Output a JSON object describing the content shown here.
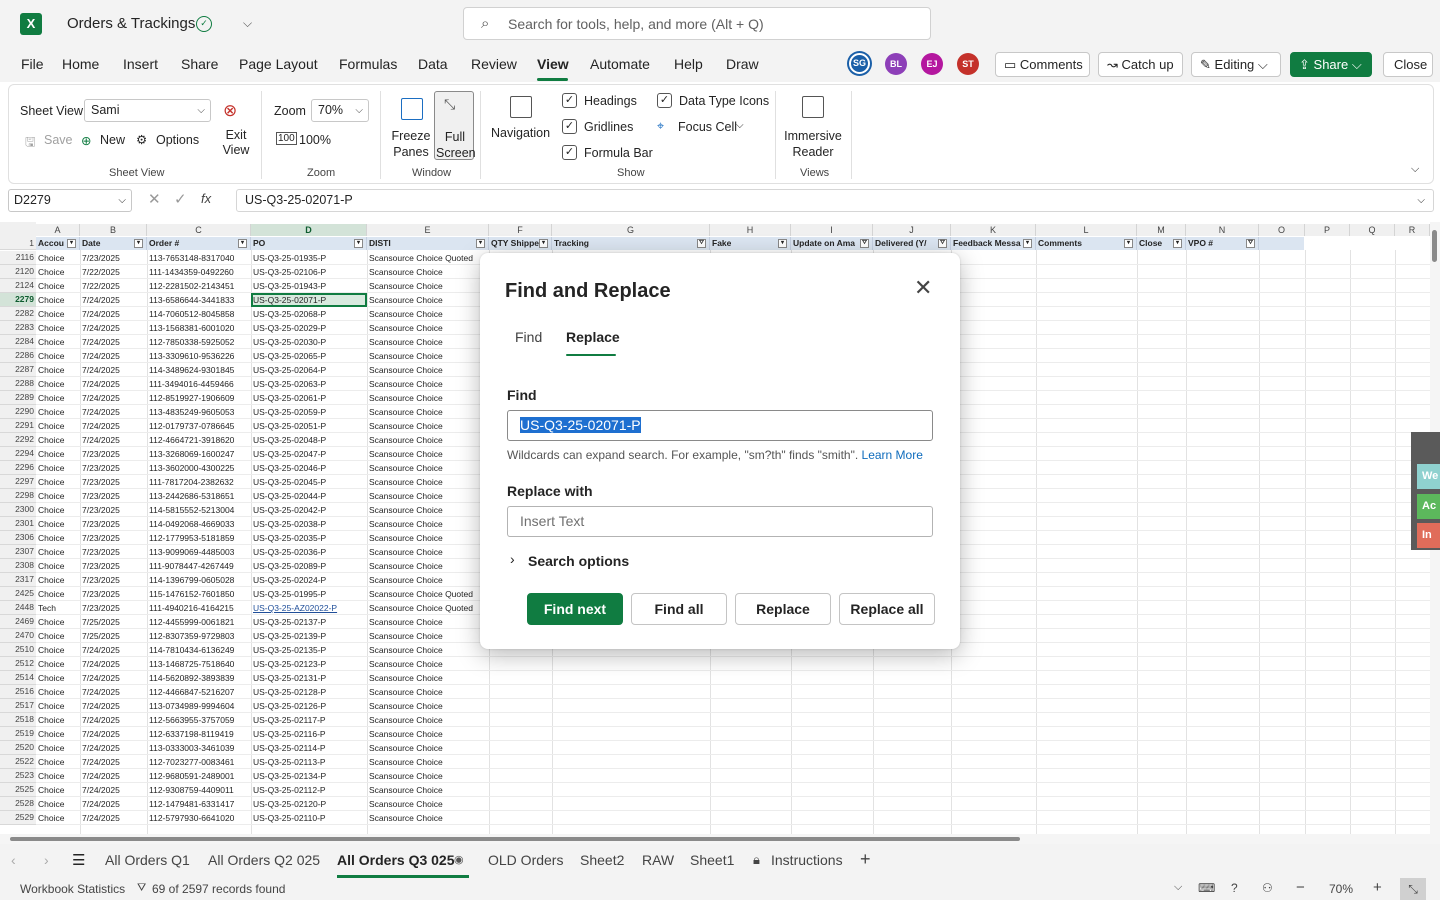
{
  "title_bar": {
    "app_icon": "X",
    "doc_title": "Orders & Trackings",
    "search_placeholder": "Search for tools, help, and more (Alt + Q)"
  },
  "menu": [
    "File",
    "Home",
    "Insert",
    "Share",
    "Page Layout",
    "Formulas",
    "Data",
    "Review",
    "View",
    "Automate",
    "Help",
    "Draw"
  ],
  "active_menu": "View",
  "avatars": [
    {
      "initials": "SG",
      "color": "#1a5fa8"
    },
    {
      "initials": "BL",
      "color": "#8d3fb8"
    },
    {
      "initials": "EJ",
      "color": "#b4179f"
    },
    {
      "initials": "ST",
      "color": "#c4312a"
    }
  ],
  "header_buttons": {
    "comments": "Comments",
    "catchup": "Catch up",
    "editing": "Editing",
    "share": "Share",
    "close": "Close"
  },
  "ribbon": {
    "sheet_view_label": "Sheet View",
    "sheet_view_value": "Sami",
    "save": "Save",
    "new": "New",
    "options": "Options",
    "exit_view": "Exit View",
    "group_sheet_view": "Sheet View",
    "zoom_label": "Zoom",
    "zoom_value": "70%",
    "zoom_100": "100%",
    "group_zoom": "Zoom",
    "freeze_panes": "Freeze Panes",
    "full_screen": "Full Screen",
    "group_window": "Window",
    "navigation": "Navigation",
    "headings": "Headings",
    "gridlines": "Gridlines",
    "formula_bar": "Formula Bar",
    "data_type_icons": "Data Type Icons",
    "focus_cell": "Focus Cell",
    "group_show": "Show",
    "immersive_reader": "Immersive Reader",
    "group_views": "Views"
  },
  "formula_bar": {
    "name_box": "D2279",
    "fx": "fx",
    "content": "US-Q3-25-02071-P"
  },
  "columns": [
    "A",
    "B",
    "C",
    "D",
    "E",
    "F",
    "G",
    "H",
    "I",
    "J",
    "K",
    "L",
    "M",
    "N",
    "O",
    "P",
    "Q",
    "R"
  ],
  "header_row": {
    "num": "1",
    "cells": [
      "Accou",
      "Date",
      "Order #",
      "PO",
      "DISTI",
      "QTY Shippe",
      "Tracking",
      "Fake",
      "Update on Ama",
      "Delivered (Y/",
      "Feedback Messa",
      "Comments",
      "Close",
      "VPO #"
    ]
  },
  "rows": [
    [
      "2116",
      "Choice",
      "7/23/2025",
      "113-7653148-8317040",
      "US-Q3-25-01935-P",
      "Scansource Choice Quoted"
    ],
    [
      "2120",
      "Choice",
      "7/22/2025",
      "111-1434359-0492260",
      "US-Q3-25-02106-P",
      "Scansource Choice"
    ],
    [
      "2124",
      "Choice",
      "7/22/2025",
      "112-2281502-2143451",
      "US-Q3-25-01943-P",
      "Scansource Choice"
    ],
    [
      "2279",
      "Choice",
      "7/24/2025",
      "113-6586644-3441833",
      "US-Q3-25-02071-P",
      "Scansource Choice"
    ],
    [
      "2282",
      "Choice",
      "7/24/2025",
      "114-7060512-8045858",
      "US-Q3-25-02068-P",
      "Scansource Choice"
    ],
    [
      "2283",
      "Choice",
      "7/24/2025",
      "113-1568381-6001020",
      "US-Q3-25-02029-P",
      "Scansource Choice"
    ],
    [
      "2284",
      "Choice",
      "7/24/2025",
      "112-7850338-5925052",
      "US-Q3-25-02030-P",
      "Scansource Choice"
    ],
    [
      "2286",
      "Choice",
      "7/24/2025",
      "113-3309610-9536226",
      "US-Q3-25-02065-P",
      "Scansource Choice"
    ],
    [
      "2287",
      "Choice",
      "7/24/2025",
      "114-3489624-9301845",
      "US-Q3-25-02064-P",
      "Scansource Choice"
    ],
    [
      "2288",
      "Choice",
      "7/24/2025",
      "111-3494016-4459466",
      "US-Q3-25-02063-P",
      "Scansource Choice"
    ],
    [
      "2289",
      "Choice",
      "7/24/2025",
      "112-8519927-1906609",
      "US-Q3-25-02061-P",
      "Scansource Choice"
    ],
    [
      "2290",
      "Choice",
      "7/24/2025",
      "113-4835249-9605053",
      "US-Q3-25-02059-P",
      "Scansource Choice"
    ],
    [
      "2291",
      "Choice",
      "7/24/2025",
      "112-0179737-0786645",
      "US-Q3-25-02051-P",
      "Scansource Choice"
    ],
    [
      "2292",
      "Choice",
      "7/24/2025",
      "112-4664721-3918620",
      "US-Q3-25-02048-P",
      "Scansource Choice"
    ],
    [
      "2294",
      "Choice",
      "7/23/2025",
      "113-3268069-1600247",
      "US-Q3-25-02047-P",
      "Scansource Choice"
    ],
    [
      "2296",
      "Choice",
      "7/23/2025",
      "113-3602000-4300225",
      "US-Q3-25-02046-P",
      "Scansource Choice"
    ],
    [
      "2297",
      "Choice",
      "7/23/2025",
      "111-7817204-2382632",
      "US-Q3-25-02045-P",
      "Scansource Choice"
    ],
    [
      "2298",
      "Choice",
      "7/23/2025",
      "113-2442686-5318651",
      "US-Q3-25-02044-P",
      "Scansource Choice"
    ],
    [
      "2300",
      "Choice",
      "7/23/2025",
      "114-5815552-5213004",
      "US-Q3-25-02042-P",
      "Scansource Choice"
    ],
    [
      "2301",
      "Choice",
      "7/23/2025",
      "114-0492068-4669033",
      "US-Q3-25-02038-P",
      "Scansource Choice"
    ],
    [
      "2306",
      "Choice",
      "7/23/2025",
      "112-1779953-5181859",
      "US-Q3-25-02035-P",
      "Scansource Choice"
    ],
    [
      "2307",
      "Choice",
      "7/23/2025",
      "113-9099069-4485003",
      "US-Q3-25-02036-P",
      "Scansource Choice"
    ],
    [
      "2308",
      "Choice",
      "7/23/2025",
      "111-9078447-4267449",
      "US-Q3-25-02089-P",
      "Scansource Choice"
    ],
    [
      "2317",
      "Choice",
      "7/23/2025",
      "114-1396799-0605028",
      "US-Q3-25-02024-P",
      "Scansource Choice"
    ],
    [
      "2425",
      "Choice",
      "7/23/2025",
      "115-1476152-7601850",
      "US-Q3-25-01995-P",
      "Scansource Choice Quoted"
    ],
    [
      "2448",
      "Tech",
      "7/23/2025",
      "111-4940216-4164215",
      "US-Q3-25-AZ02022-P",
      "Scansource Choice Quoted"
    ],
    [
      "2469",
      "Choice",
      "7/25/2025",
      "112-4455999-0061821",
      "US-Q3-25-02137-P",
      "Scansource Choice"
    ],
    [
      "2470",
      "Choice",
      "7/25/2025",
      "112-8307359-9729803",
      "US-Q3-25-02139-P",
      "Scansource Choice"
    ],
    [
      "2510",
      "Choice",
      "7/24/2025",
      "114-7810434-6136249",
      "US-Q3-25-02135-P",
      "Scansource Choice"
    ],
    [
      "2512",
      "Choice",
      "7/24/2025",
      "113-1468725-7518640",
      "US-Q3-25-02123-P",
      "Scansource Choice"
    ],
    [
      "2514",
      "Choice",
      "7/24/2025",
      "114-5620892-3893839",
      "US-Q3-25-02131-P",
      "Scansource Choice"
    ],
    [
      "2516",
      "Choice",
      "7/24/2025",
      "112-4466847-5216207",
      "US-Q3-25-02128-P",
      "Scansource Choice"
    ],
    [
      "2517",
      "Choice",
      "7/24/2025",
      "113-0734989-9994604",
      "US-Q3-25-02126-P",
      "Scansource Choice"
    ],
    [
      "2518",
      "Choice",
      "7/24/2025",
      "112-5663955-3757059",
      "US-Q3-25-02117-P",
      "Scansource Choice"
    ],
    [
      "2519",
      "Choice",
      "7/24/2025",
      "112-6337198-8119419",
      "US-Q3-25-02116-P",
      "Scansource Choice"
    ],
    [
      "2520",
      "Choice",
      "7/24/2025",
      "113-0333003-3461039",
      "US-Q3-25-02114-P",
      "Scansource Choice"
    ],
    [
      "2522",
      "Choice",
      "7/24/2025",
      "112-7023277-0083461",
      "US-Q3-25-02113-P",
      "Scansource Choice"
    ],
    [
      "2523",
      "Choice",
      "7/24/2025",
      "112-9680591-2489001",
      "US-Q3-25-02134-P",
      "Scansource Choice"
    ],
    [
      "2525",
      "Choice",
      "7/24/2025",
      "112-9308759-4409011",
      "US-Q3-25-02112-P",
      "Scansource Choice"
    ],
    [
      "2528",
      "Choice",
      "7/24/2025",
      "112-1479481-6331417",
      "US-Q3-25-02120-P",
      "Scansource Choice"
    ],
    [
      "2529",
      "Choice",
      "7/24/2025",
      "112-5797930-6641020",
      "US-Q3-25-02110-P",
      "Scansource Choice"
    ]
  ],
  "side_panel": [
    "We",
    "Ac",
    "In"
  ],
  "sheet_tabs": [
    "All Orders Q1",
    "All Orders Q2 025",
    "All Orders Q3 025",
    "OLD Orders",
    "Sheet2",
    "RAW",
    "Sheet1",
    "Instructions"
  ],
  "active_tab": "All Orders Q3 025",
  "status": {
    "workbook_stats": "Workbook Statistics",
    "records": "69 of 2597 records found",
    "zoom": "70%"
  },
  "dialog": {
    "title": "Find and Replace",
    "tabs": [
      "Find",
      "Replace"
    ],
    "active_tab": "Replace",
    "find_label": "Find",
    "find_value": "US-Q3-25-02071-P",
    "hint": "Wildcards can expand search. For example, \"sm?th\" finds \"smith\".",
    "learn_more": "Learn More",
    "replace_label": "Replace with",
    "replace_placeholder": "Insert Text",
    "search_options": "Search options",
    "buttons": {
      "find_next": "Find next",
      "find_all": "Find all",
      "replace": "Replace",
      "replace_all": "Replace all"
    }
  }
}
